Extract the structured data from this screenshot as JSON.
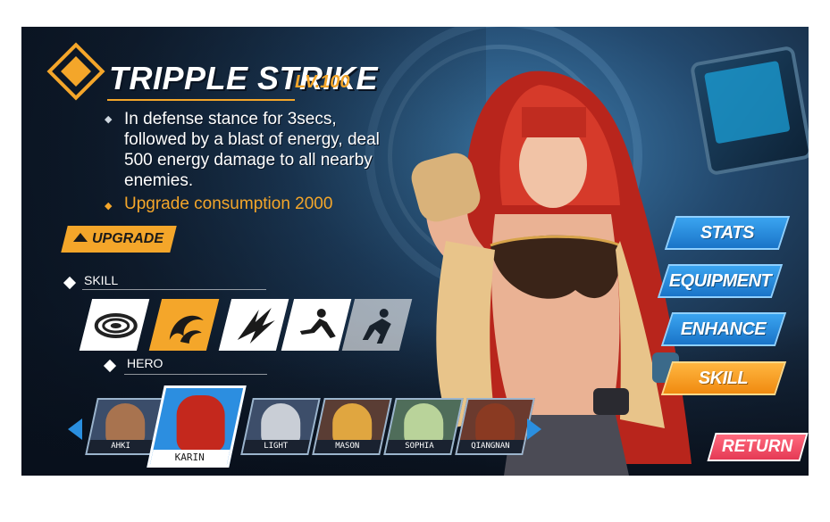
{
  "skill_info": {
    "name": "TRIPPLE STRIKE",
    "level": "LV.100",
    "description": "In defense stance for 3secs, followed by a blast of energy, deal 500 energy damage to all nearby enemies.",
    "upgrade_consumption": "Upgrade consumption 2000",
    "upgrade_button": "UPGRADE"
  },
  "skills": {
    "header": "SKILL",
    "icons": [
      "whirlwind-skill-icon",
      "wave-slash-skill-icon",
      "claw-strike-skill-icon",
      "shadow-kick-skill-icon",
      "shadow-dash-skill-icon"
    ],
    "selected_index": 1
  },
  "heroes": {
    "header": "HERO",
    "list": [
      "AHKI",
      "KARIN",
      "LIGHT",
      "MASON",
      "SOPHIA",
      "QIANGNAN"
    ],
    "selected": "KARIN"
  },
  "menu": {
    "stats": "STATS",
    "equipment": "EQUIPMENT",
    "enhance": "ENHANCE",
    "skill": "SKILL",
    "active": "SKILL"
  },
  "return_label": "RETURN",
  "colors": {
    "accent": "#f4a62a",
    "menu_blue": "#2a8fe0",
    "return_red": "#e8455e",
    "background": "#1c3650"
  }
}
